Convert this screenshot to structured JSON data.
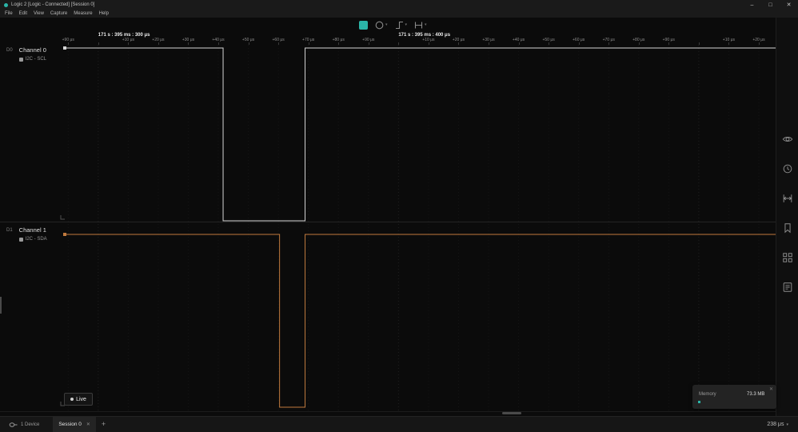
{
  "window": {
    "title": "Logic 2 [Logic - Connected] [Session 0]",
    "minimize": "–",
    "maximize": "□",
    "close": "✕"
  },
  "menu": {
    "items": [
      "File",
      "Edit",
      "View",
      "Capture",
      "Measure",
      "Help"
    ]
  },
  "icons": {
    "chevron_down": "▾"
  },
  "colors": {
    "accent_teal": "#2bb5a8",
    "background": "#0b0b0b"
  },
  "toolbar": {
    "buttons": [
      {
        "name": "stop-capture",
        "icon": "stop-square"
      },
      {
        "name": "timer-mode",
        "icon": "circle",
        "dropdown": true
      },
      {
        "name": "trigger-mode",
        "icon": "edge",
        "dropdown": true
      },
      {
        "name": "pulse-mode",
        "icon": "pulse",
        "dropdown": true
      }
    ]
  },
  "ruler": {
    "start_us": 288.6,
    "end_us": 525.6,
    "tick_step_us": 10,
    "major_step_us": 100,
    "minor_label_prefix": "+",
    "minor_label_suffix": " μs",
    "majors": [
      {
        "us": 300,
        "label": "171 s : 395 ms : 300 μs"
      },
      {
        "us": 400,
        "label": "171 s : 395 ms : 400 μs"
      }
    ]
  },
  "channels": [
    {
      "id": "D0",
      "name": "Channel 0",
      "analyzer": "I2C - SCL",
      "color": "#d6d6d6",
      "initial_state": "high",
      "edges_us": [
        341.6,
        368.9
      ]
    },
    {
      "id": "D1",
      "name": "Channel 1",
      "analyzer": "I2C - SDA",
      "color": "#c07a3e",
      "initial_state": "high",
      "edges_us": [
        360.4,
        368.9
      ]
    }
  ],
  "right_rail": {
    "icons": [
      "eye",
      "clock",
      "measure",
      "bookmark",
      "grid",
      "note"
    ]
  },
  "live_button": {
    "label": "Live"
  },
  "memory_popup": {
    "title": "Memory",
    "value": "73.3 MB",
    "close": "✕"
  },
  "status_bar": {
    "device": {
      "label": "1 Device"
    },
    "tabs": [
      {
        "label": "Session 0",
        "close": "✕",
        "active": true
      }
    ],
    "new_tab": "+",
    "time_span": "238 μs"
  }
}
